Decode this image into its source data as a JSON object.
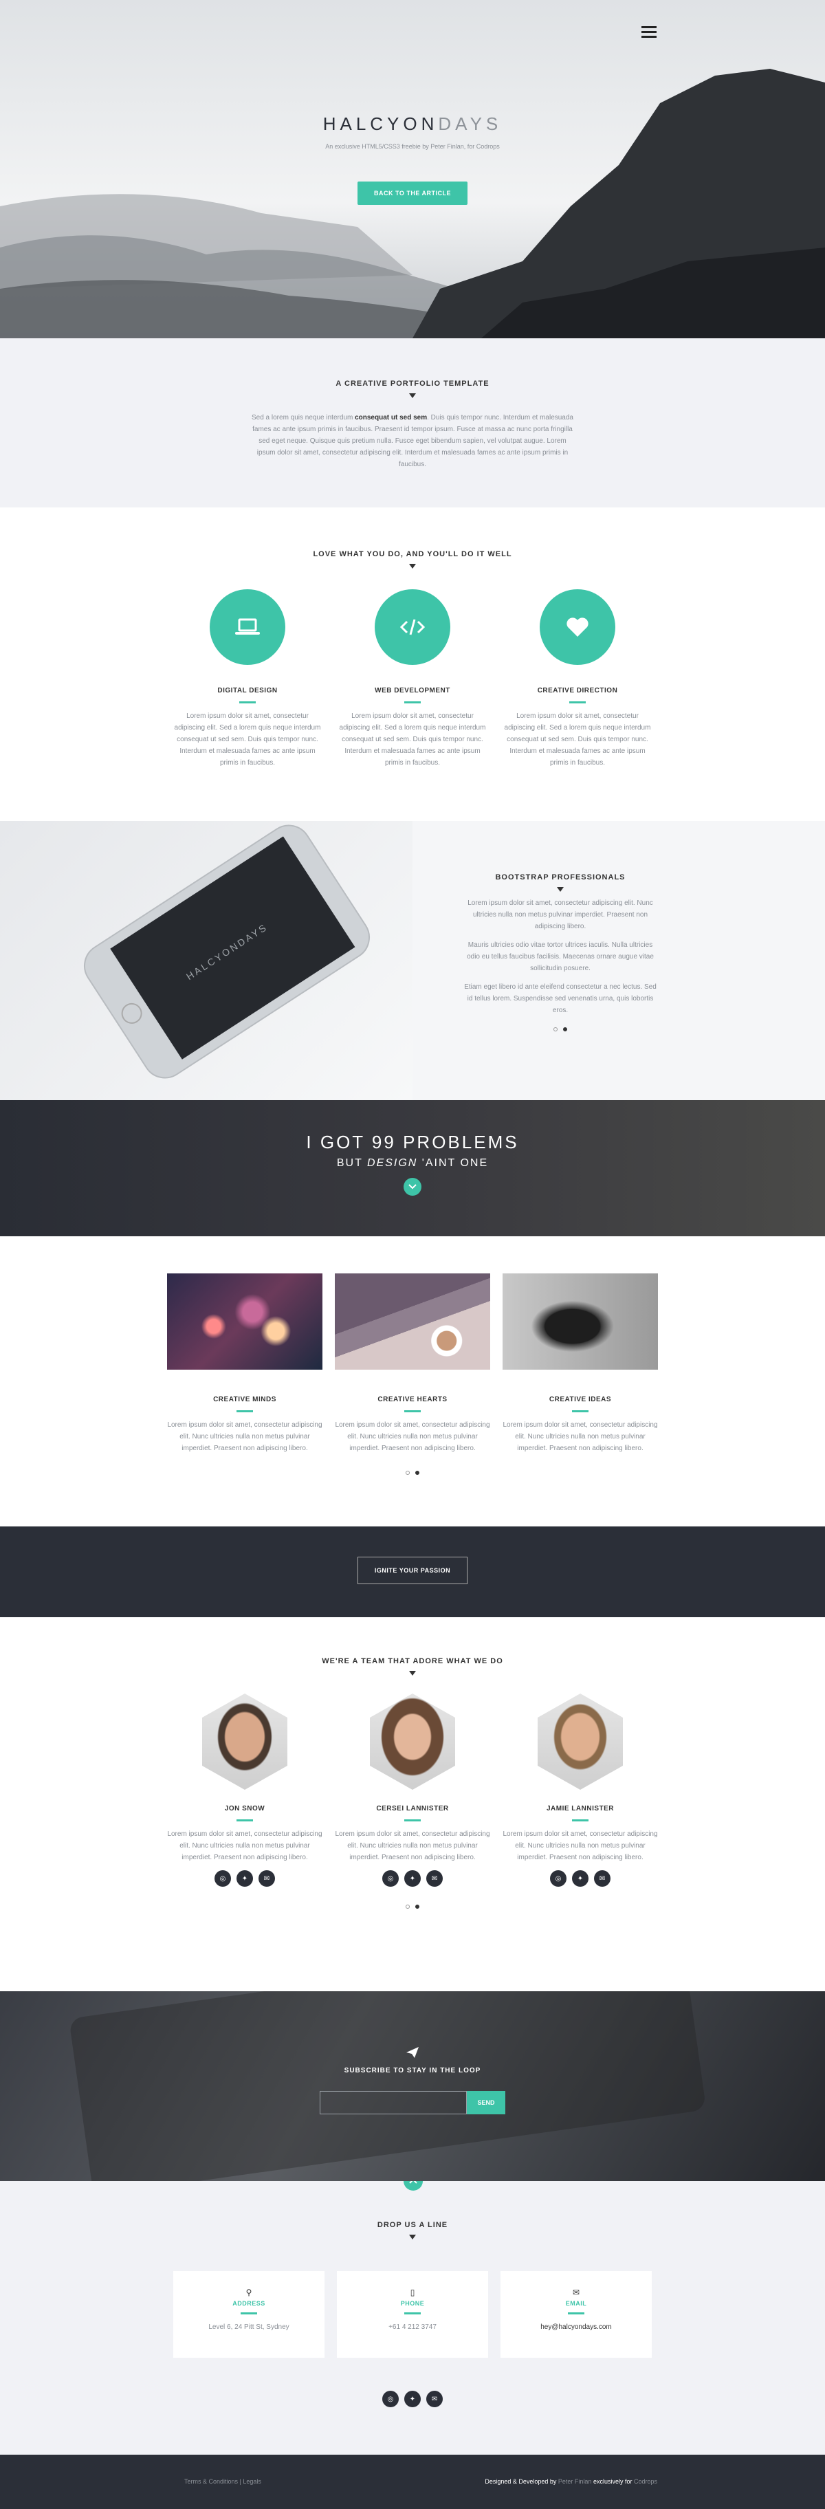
{
  "hero": {
    "logo_a": "HALCYON",
    "logo_b": "DAYS",
    "tagline": "An exclusive HTML5/CSS3 freebie by Peter Finlan, for Codrops",
    "button": "BACK TO THE ARTICLE",
    "menu_icon": "hamburger-icon"
  },
  "intro": {
    "heading": "A CREATIVE PORTFOLIO TEMPLATE",
    "text_a": "Sed a lorem quis neque interdum ",
    "text_strong": "consequat ut sed sem",
    "text_b": ". Duis quis tempor nunc. Interdum et malesuada fames ac ante ipsum primis in faucibus. Praesent id tempor ipsum. Fusce at massa ac nunc porta fringilla sed eget neque. Quisque quis pretium nulla. Fusce eget bibendum sapien, vel volutpat augue. Lorem ipsum dolor sit amet, consectetur adipiscing elit. Interdum et malesuada fames ac ante ipsum primis in faucibus."
  },
  "services": {
    "heading": "LOVE WHAT YOU DO, AND YOU'LL DO IT WELL",
    "items": [
      {
        "title": "DIGITAL DESIGN",
        "icon": "laptop-icon",
        "text": "Lorem ipsum dolor sit amet, consectetur adipiscing elit. Sed a lorem quis neque interdum consequat ut sed sem. Duis quis tempor nunc. Interdum et malesuada fames ac ante ipsum primis in faucibus."
      },
      {
        "title": "WEB DEVELOPMENT",
        "icon": "code-icon",
        "text": "Lorem ipsum dolor sit amet, consectetur adipiscing elit. Sed a lorem quis neque interdum consequat ut sed sem. Duis quis tempor nunc. Interdum et malesuada fames ac ante ipsum primis in faucibus."
      },
      {
        "title": "CREATIVE DIRECTION",
        "icon": "heart-icon",
        "text": "Lorem ipsum dolor sit amet, consectetur adipiscing elit. Sed a lorem quis neque interdum consequat ut sed sem. Duis quis tempor nunc. Interdum et malesuada fames ac ante ipsum primis in faucibus."
      }
    ]
  },
  "bootstrap": {
    "heading": "BOOTSTRAP PROFESSIONALS",
    "p1": "Lorem ipsum dolor sit amet, consectetur adipiscing elit. Nunc ultricies nulla non metus pulvinar imperdiet. Praesent non adipiscing libero.",
    "p2": "Mauris ultricies odio vitae tortor ultrices iaculis. Nulla ultricies odio eu tellus faucibus facilisis. Maecenas ornare augue vitae sollicitudin posuere.",
    "p3": "Etiam eget libero id ante eleifend consectetur a nec lectus. Sed id tellus lorem. Suspendisse sed venenatis urna, quis lobortis eros.",
    "phone_logo": "HALCYONDAYS"
  },
  "problems": {
    "line1": "I GOT 99 PROBLEMS",
    "line2a": "BUT ",
    "line2b": "DESIGN",
    "line2c": " 'AINT ONE"
  },
  "portfolio": {
    "items": [
      {
        "title": "CREATIVE MINDS",
        "text": "Lorem ipsum dolor sit amet, consectetur adipiscing elit. Nunc ultricies nulla non metus pulvinar imperdiet. Praesent non adipiscing libero."
      },
      {
        "title": "CREATIVE HEARTS",
        "text": "Lorem ipsum dolor sit amet, consectetur adipiscing elit. Nunc ultricies nulla non metus pulvinar imperdiet. Praesent non adipiscing libero."
      },
      {
        "title": "CREATIVE IDEAS",
        "text": "Lorem ipsum dolor sit amet, consectetur adipiscing elit. Nunc ultricies nulla non metus pulvinar imperdiet. Praesent non adipiscing libero."
      }
    ]
  },
  "ignite": {
    "button": "IGNITE YOUR PASSION"
  },
  "team": {
    "heading": "WE'RE A TEAM THAT ADORE WHAT WE DO",
    "members": [
      {
        "name": "JON SNOW",
        "text": "Lorem ipsum dolor sit amet, consectetur adipiscing elit. Nunc ultricies nulla non metus pulvinar imperdiet. Praesent non adipiscing libero."
      },
      {
        "name": "CERSEI LANNISTER",
        "text": "Lorem ipsum dolor sit amet, consectetur adipiscing elit. Nunc ultricies nulla non metus pulvinar imperdiet. Praesent non adipiscing libero."
      },
      {
        "name": "JAMIE LANNISTER",
        "text": "Lorem ipsum dolor sit amet, consectetur adipiscing elit. Nunc ultricies nulla non metus pulvinar imperdiet. Praesent non adipiscing libero."
      }
    ]
  },
  "subscribe": {
    "heading": "SUBSCRIBE TO STAY IN THE LOOP",
    "placeholder": "",
    "button": "SEND"
  },
  "contact": {
    "heading": "DROP US A LINE",
    "address_label": "ADDRESS",
    "address": "Level 6, 24 Pitt St, Sydney",
    "phone_label": "PHONE",
    "phone": "+61 4 212 3747",
    "email_label": "EMAIL",
    "email": "hey@halcyondays.com"
  },
  "footer": {
    "terms": "Terms & Conditions",
    "sep": " | ",
    "legals": "Legals",
    "credit_a": "Designed & Developed by ",
    "credit_name": "Peter Finlan",
    "credit_b": " exclusively for ",
    "credit_site": "Codrops"
  },
  "colors": {
    "accent": "#3ec4a8",
    "dark": "#2b2f38"
  }
}
